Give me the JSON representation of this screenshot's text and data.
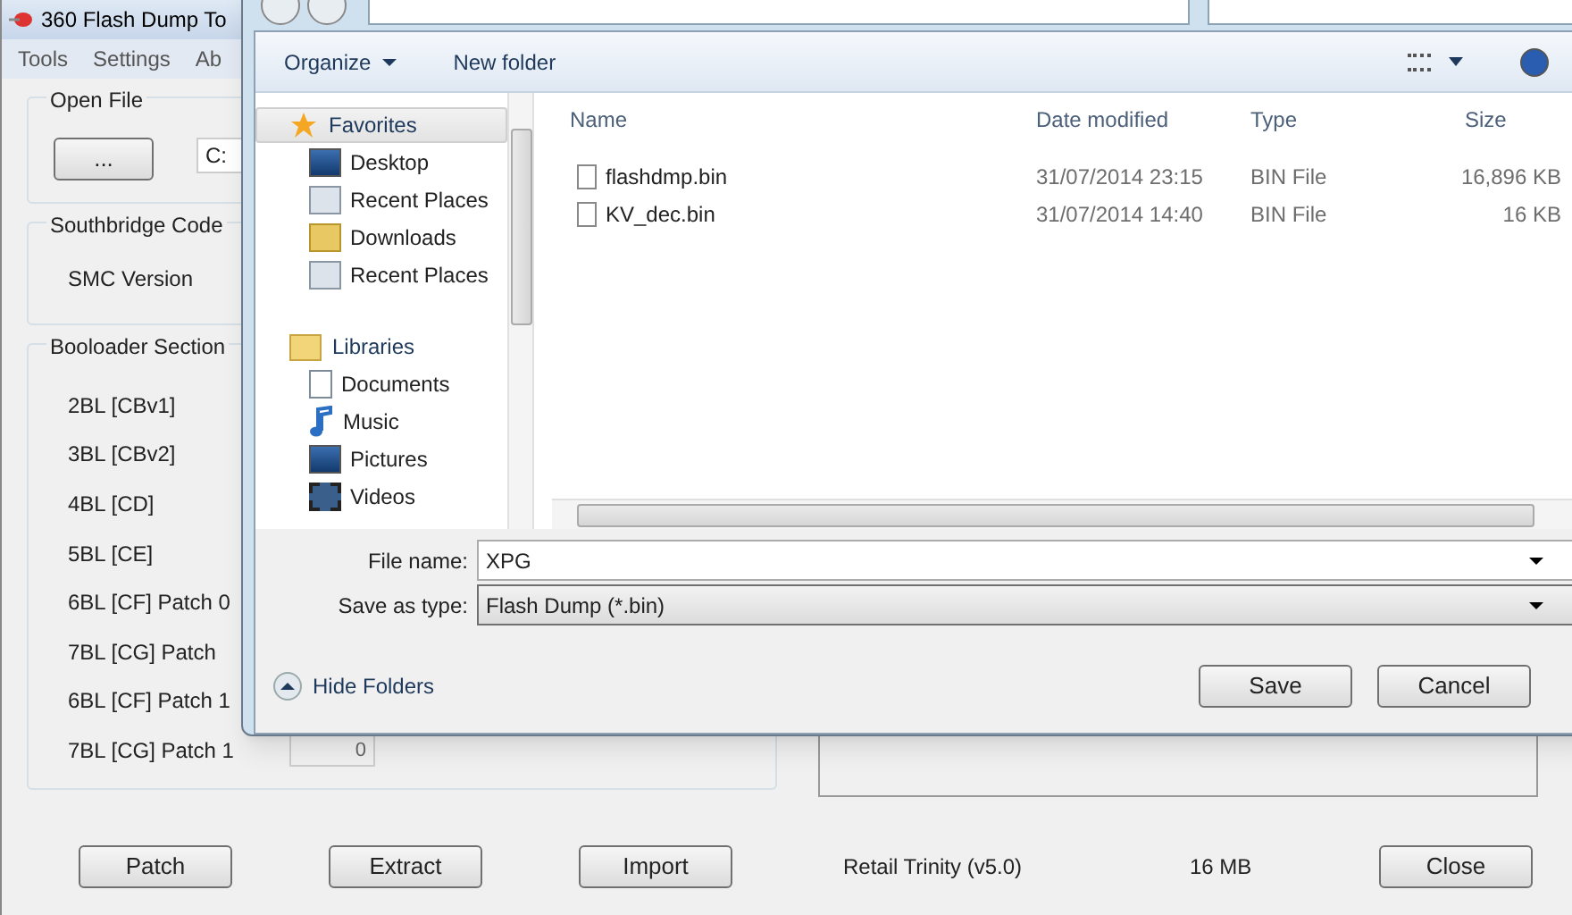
{
  "app": {
    "title": "360 Flash Dump To",
    "menu": [
      "Tools",
      "Settings",
      "Ab"
    ],
    "open_file": {
      "label": "Open File",
      "button": "...",
      "path": "C:"
    },
    "southbridge": {
      "label": "Southbridge Code",
      "smc_label": "SMC Version"
    },
    "bootloader": {
      "label": "Booloader Section",
      "rows": [
        {
          "label": "2BL [CBv1]"
        },
        {
          "label": "3BL [CBv2]"
        },
        {
          "label": "4BL [CD]"
        },
        {
          "label": "5BL [CE]"
        },
        {
          "label": "6BL [CF] Patch 0"
        },
        {
          "label": "7BL [CG] Patch"
        },
        {
          "label": "6BL [CF] Patch 1"
        },
        {
          "label": "7BL [CG] Patch 1",
          "value": "0"
        }
      ]
    },
    "buttons": [
      "Patch",
      "Extract",
      "Import"
    ],
    "status": "Retail Trinity (v5.0)",
    "size": "16 MB",
    "close": "Close"
  },
  "dialog": {
    "toolbar": {
      "organize": "Organize",
      "new_folder": "New folder"
    },
    "nav": [
      {
        "label": "Favorites",
        "selected": true,
        "children": [
          {
            "label": "Desktop"
          },
          {
            "label": "Recent Places"
          },
          {
            "label": "Downloads"
          },
          {
            "label": "Recent Places"
          }
        ]
      },
      {
        "label": "Libraries",
        "selected": false,
        "children": [
          {
            "label": "Documents"
          },
          {
            "label": "Music"
          },
          {
            "label": "Pictures"
          },
          {
            "label": "Videos"
          }
        ]
      }
    ],
    "columns": [
      "Name",
      "Date modified",
      "Type",
      "Size"
    ],
    "rows": [
      {
        "name": "flashdmp.bin",
        "date": "31/07/2014 23:15",
        "type": "BIN File",
        "size": "16,896 KB"
      },
      {
        "name": "KV_dec.bin",
        "date": "31/07/2014 14:40",
        "type": "BIN File",
        "size": "16 KB"
      }
    ],
    "file_name_label": "File name:",
    "file_name": "XPG",
    "save_type_label": "Save as type:",
    "save_type": "Flash Dump (*.bin)",
    "hide_folders": "Hide Folders",
    "buttons": [
      "Save",
      "Cancel"
    ]
  }
}
